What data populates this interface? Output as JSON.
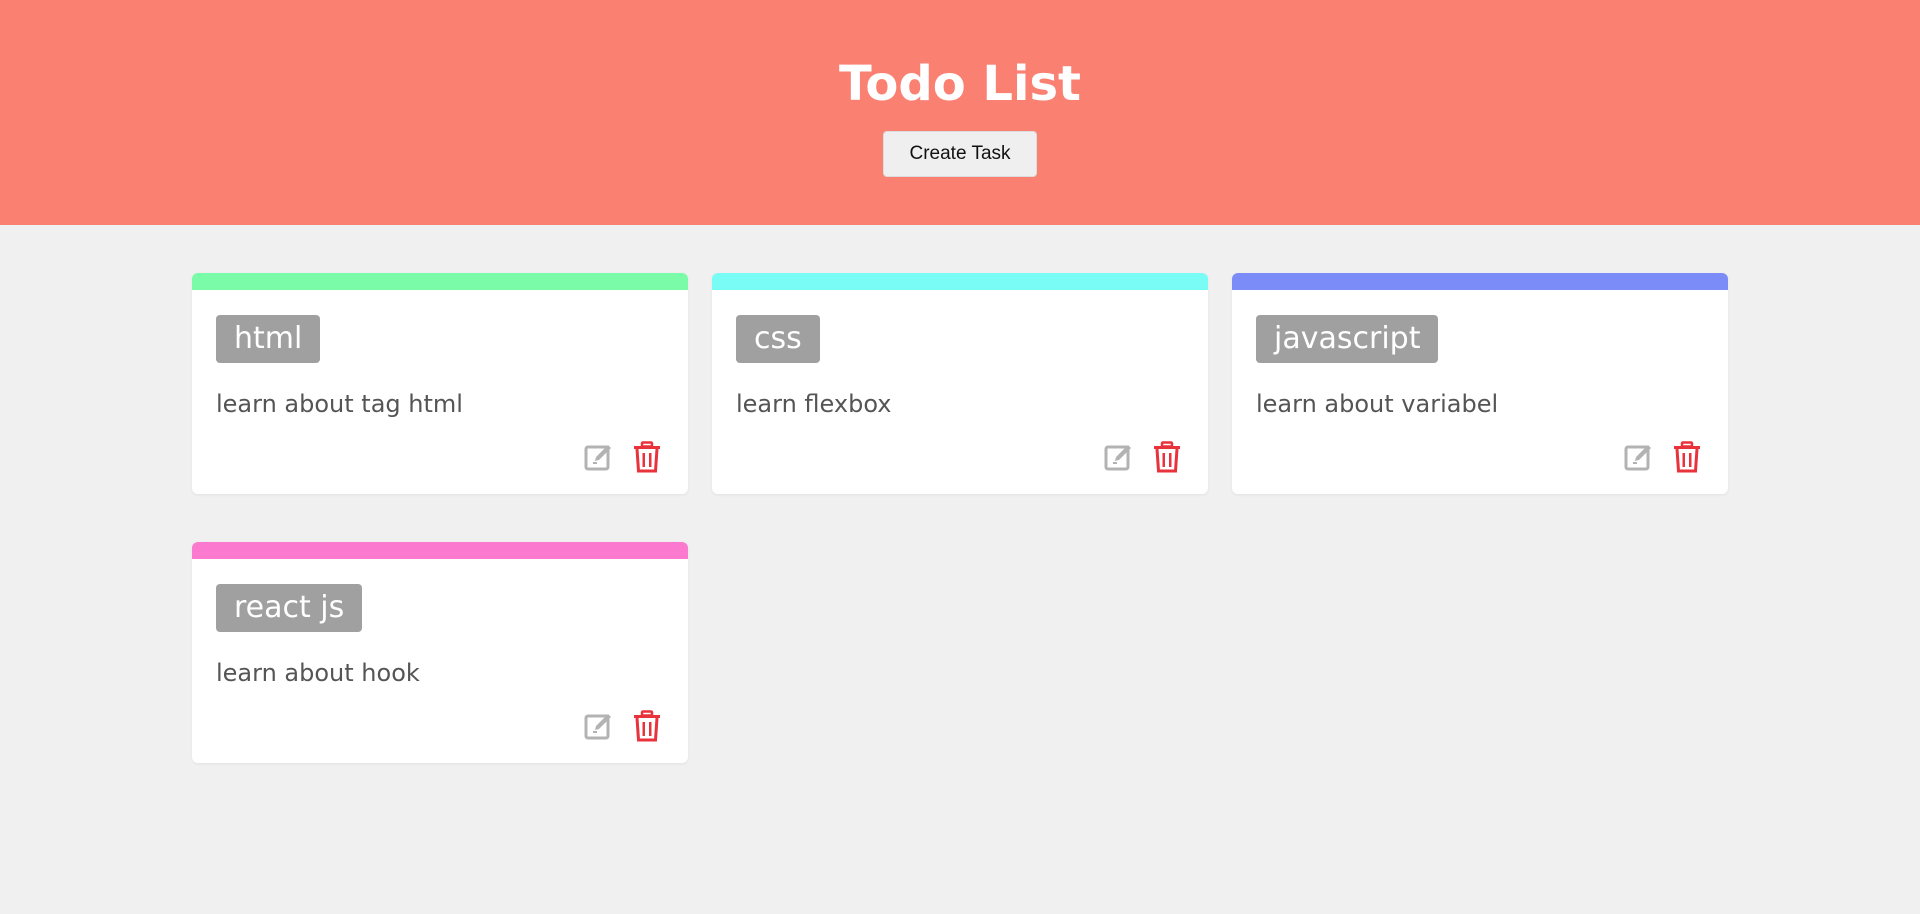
{
  "header": {
    "title": "Todo List",
    "create_label": "Create Task",
    "background": "#fa8072"
  },
  "tasks": [
    {
      "tag": "html",
      "description": "learn about tag html",
      "color": "#7afba8",
      "edit_icon": "edit-icon",
      "delete_icon": "trash-icon"
    },
    {
      "tag": "css",
      "description": "learn flexbox",
      "color": "#79fbf6",
      "edit_icon": "edit-icon",
      "delete_icon": "trash-icon"
    },
    {
      "tag": "javascript",
      "description": "learn about variabel",
      "color": "#7b8cf8",
      "edit_icon": "edit-icon",
      "delete_icon": "trash-icon"
    },
    {
      "tag": "react js",
      "description": "learn about hook",
      "color": "#fb7ad0",
      "edit_icon": "edit-icon",
      "delete_icon": "trash-icon"
    }
  ],
  "colors": {
    "tag_bg": "#a0a0a0",
    "edit_icon": "#b3b3b3",
    "delete_icon": "#e8323c"
  }
}
